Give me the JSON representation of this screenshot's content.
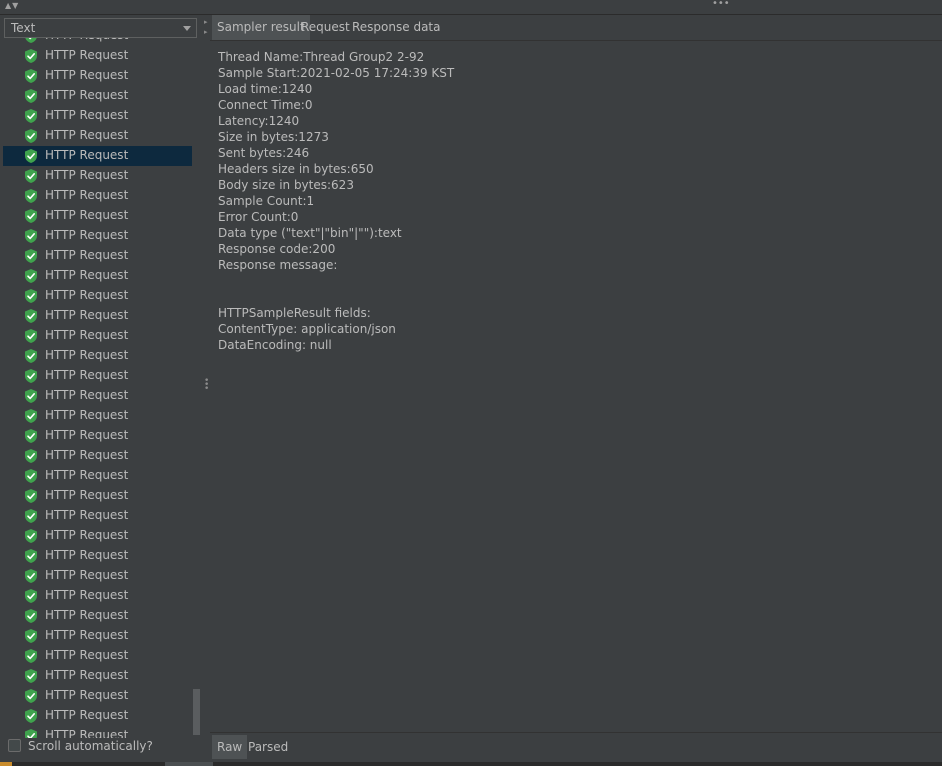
{
  "topbar": {
    "arrows": "▲▼",
    "dots": "•••"
  },
  "left": {
    "view_select": {
      "value": "Text"
    },
    "items": [
      {
        "label": "HTTP Request",
        "status": "success"
      },
      {
        "label": "HTTP Request",
        "status": "success"
      },
      {
        "label": "HTTP Request",
        "status": "success"
      },
      {
        "label": "HTTP Request",
        "status": "success"
      },
      {
        "label": "HTTP Request",
        "status": "success"
      },
      {
        "label": "HTTP Request",
        "status": "success"
      },
      {
        "label": "HTTP Request",
        "status": "success",
        "selected": true
      },
      {
        "label": "HTTP Request",
        "status": "success"
      },
      {
        "label": "HTTP Request",
        "status": "success"
      },
      {
        "label": "HTTP Request",
        "status": "success"
      },
      {
        "label": "HTTP Request",
        "status": "success"
      },
      {
        "label": "HTTP Request",
        "status": "success"
      },
      {
        "label": "HTTP Request",
        "status": "success"
      },
      {
        "label": "HTTP Request",
        "status": "success"
      },
      {
        "label": "HTTP Request",
        "status": "success"
      },
      {
        "label": "HTTP Request",
        "status": "success"
      },
      {
        "label": "HTTP Request",
        "status": "success"
      },
      {
        "label": "HTTP Request",
        "status": "success"
      },
      {
        "label": "HTTP Request",
        "status": "success"
      },
      {
        "label": "HTTP Request",
        "status": "success"
      },
      {
        "label": "HTTP Request",
        "status": "success"
      },
      {
        "label": "HTTP Request",
        "status": "success"
      },
      {
        "label": "HTTP Request",
        "status": "success"
      },
      {
        "label": "HTTP Request",
        "status": "success"
      },
      {
        "label": "HTTP Request",
        "status": "success"
      },
      {
        "label": "HTTP Request",
        "status": "success"
      },
      {
        "label": "HTTP Request",
        "status": "success"
      },
      {
        "label": "HTTP Request",
        "status": "success"
      },
      {
        "label": "HTTP Request",
        "status": "success"
      },
      {
        "label": "HTTP Request",
        "status": "success"
      },
      {
        "label": "HTTP Request",
        "status": "success"
      },
      {
        "label": "HTTP Request",
        "status": "success"
      },
      {
        "label": "HTTP Request",
        "status": "success"
      },
      {
        "label": "HTTP Request",
        "status": "success"
      },
      {
        "label": "HTTP Request",
        "status": "success"
      },
      {
        "label": "HTTP Request",
        "status": "success"
      }
    ],
    "scroll_automatically": {
      "label": "Scroll automatically?",
      "checked": false
    }
  },
  "right": {
    "tabs": [
      "Sampler result",
      "Request",
      "Response data"
    ],
    "active_tab": "Sampler result",
    "sampler_result": [
      "Thread Name:Thread Group2 2-92",
      "Sample Start:2021-02-05 17:24:39 KST",
      "Load time:1240",
      "Connect Time:0",
      "Latency:1240",
      "Size in bytes:1273",
      "Sent bytes:246",
      "Headers size in bytes:650",
      "Body size in bytes:623",
      "Sample Count:1",
      "Error Count:0",
      "Data type (\"text\"|\"bin\"|\"\"):text",
      "Response code:200",
      "Response message:",
      "",
      "",
      "HTTPSampleResult fields:",
      "ContentType: application/json",
      "DataEncoding: null"
    ],
    "bottom_tabs": [
      "Raw",
      "Parsed"
    ],
    "active_bottom_tab": "Raw"
  },
  "colors": {
    "background": "#3c3f41",
    "selected_row": "#0d293e",
    "success_icon": "#3fa34d",
    "text": "#bbbbbb"
  }
}
